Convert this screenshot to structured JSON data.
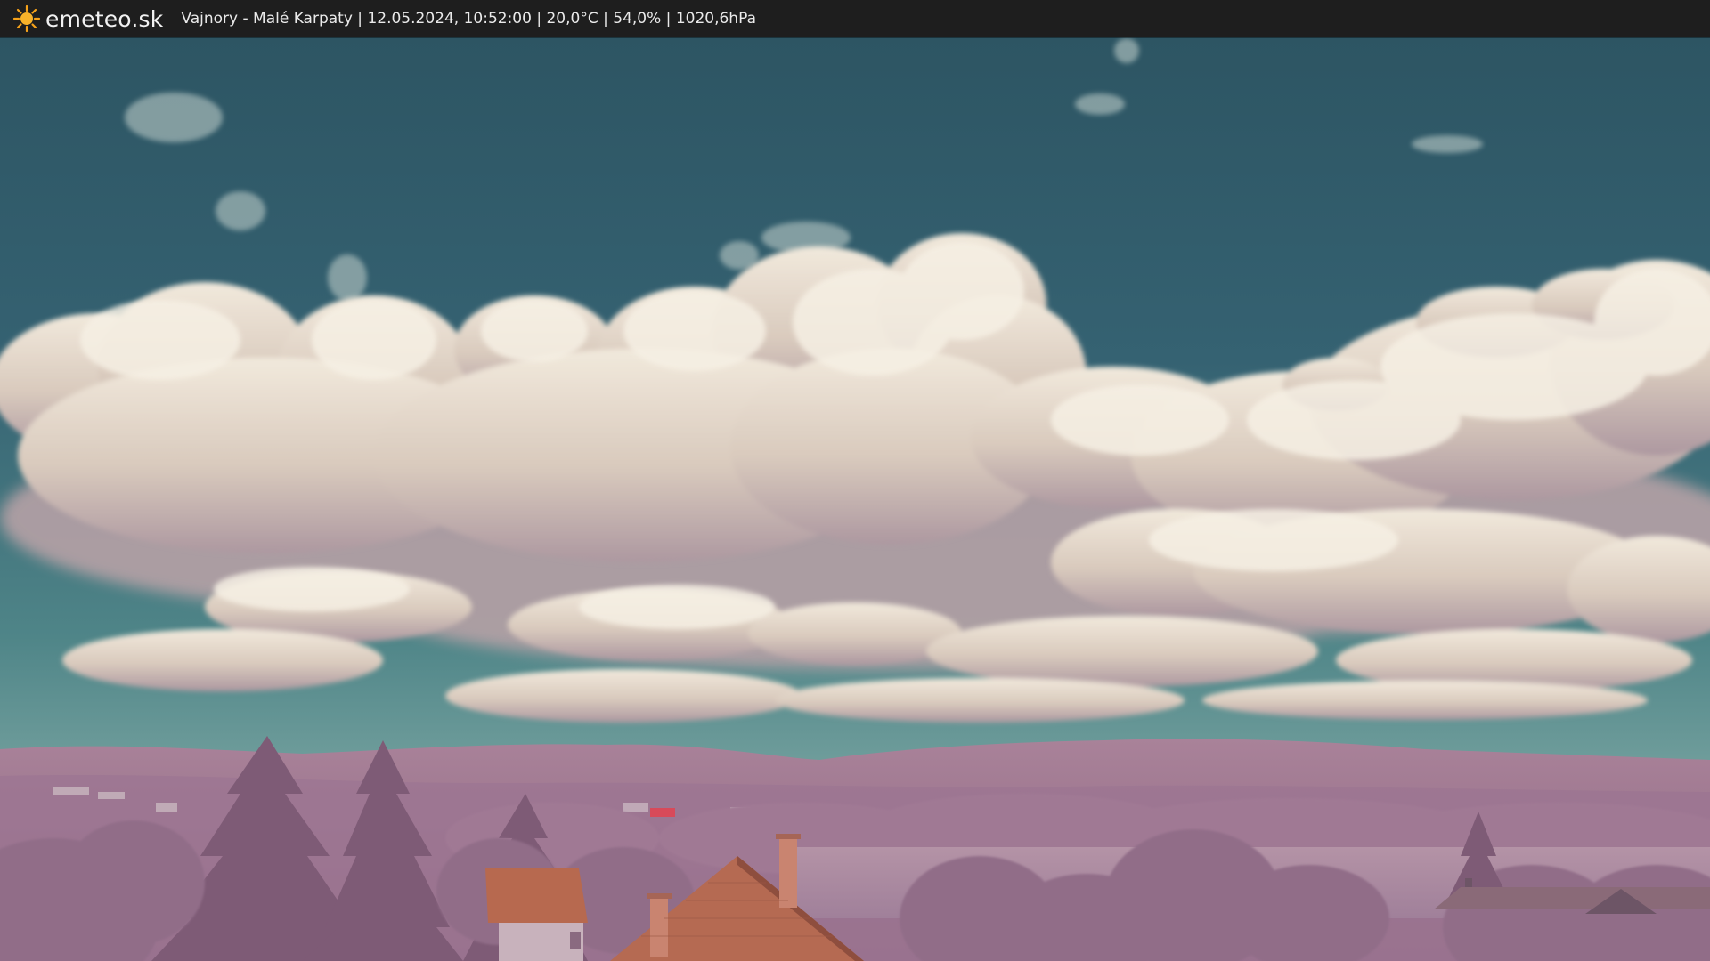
{
  "header": {
    "brand": "emeteo.sk",
    "brand_icon": "sun-icon",
    "location": "Vajnory - Malé Karpaty",
    "datetime": "12.05.2024, 10:52:00",
    "temperature": "20,0°C",
    "humidity": "54,0%",
    "pressure": "1020,6hPa",
    "separator": " | "
  },
  "scene": {
    "description_type": "webcam image",
    "colors": {
      "sky_top": "#2f5866",
      "sky_horizon": "#6f9a98",
      "cloud": "#ebe3d4",
      "cloud_shadow": "#b9a6a8",
      "hills": "#a27a98",
      "trees": "#8f6a86",
      "roof": "#b86a50"
    }
  }
}
